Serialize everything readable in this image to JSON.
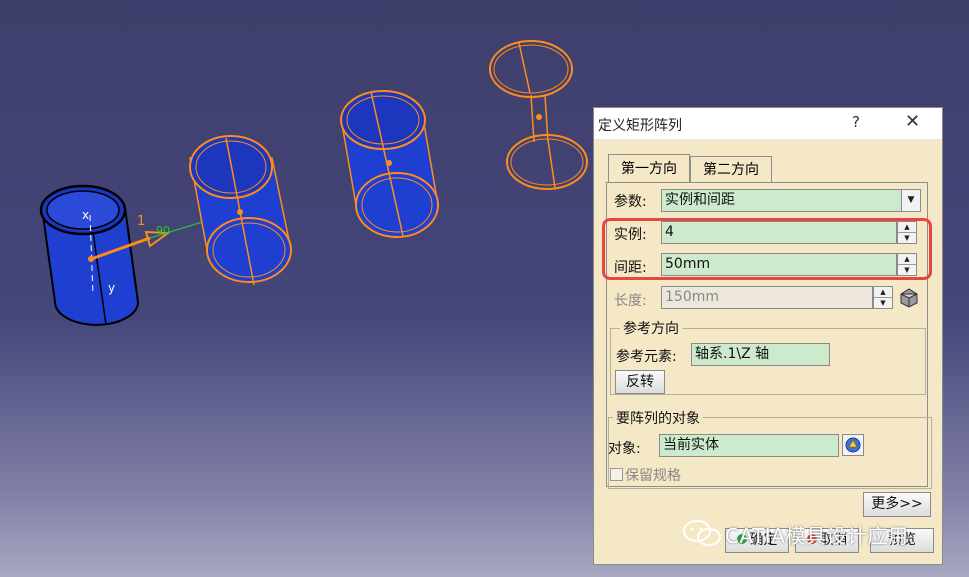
{
  "dialog": {
    "title": "定义矩形阵列",
    "help": "?",
    "close": "✕",
    "tabs": [
      "第一方向",
      "第二方向"
    ],
    "params": {
      "label": "参数:",
      "value": "实例和间距"
    },
    "instances": {
      "label": "实例:",
      "value": "4"
    },
    "spacing": {
      "label": "间距:",
      "value": "50mm"
    },
    "length": {
      "label": "长度:",
      "value": "150mm"
    },
    "reference": {
      "legend": "参考方向",
      "label": "参考元素:",
      "value": "轴系.1\\Z 轴",
      "reverse": "反转"
    },
    "objects": {
      "legend": "要阵列的对象",
      "label": "对象:",
      "value": "当前实体",
      "keep_spec": "保留规格"
    },
    "more_button": "更多>>",
    "ok_button": "确定",
    "cancel_button": "取消",
    "preview_button": "预览"
  },
  "viewport": {
    "axis_x": "x",
    "axis_y": "y",
    "dim_number": "1",
    "dim_angle": "90"
  },
  "watermark": "CATIA模具设计应用"
}
